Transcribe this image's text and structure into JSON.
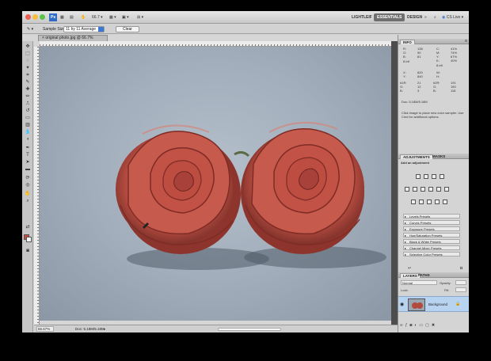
{
  "appbar": {
    "zoom": "66.7",
    "workspaces": [
      "LIGHTLEIF",
      "ESSENTIALS",
      "DESIGN"
    ],
    "cs_live": "CS Live"
  },
  "options": {
    "sample_size_label": "Sample Size:",
    "sample_size_value": "11 by 11 Average",
    "clear_label": "Clear"
  },
  "document": {
    "tab_title": "original photo.jpg @ 66.7% (RGB/8) *",
    "zoom_field": "66.67%",
    "doc_info": "Doc: 5.18M/5.18M"
  },
  "info_panel": {
    "tab": "INFO",
    "rgb": {
      "labels": "R:\nG:\nB:",
      "values": "138\n90\n81",
      "bit": "8-bit"
    },
    "cmyk": {
      "labels": "C:\nM:\nY:\nK:",
      "values": "41%\n74%\n67%\n40%",
      "bit": "8-bit"
    },
    "xy": {
      "labels": "X:\nY:",
      "values": "820\n840"
    },
    "wh": {
      "labels": "W:\nH:",
      "values": ""
    },
    "s1": {
      "labels": "#1R:\nG:\nB:",
      "values": "21\n12\n3"
    },
    "s2": {
      "labels": "#2R:\nG:\nB:",
      "values": "191\n150\n118"
    },
    "doc": "Doc: 5.18M/5.18M",
    "hint": "Click image to place new color sampler. Use Cmd for additional options."
  },
  "adjustments": {
    "tab_adj": "ADJUSTMENTS",
    "tab_masks": "MASKS",
    "heading": "Add an adjustment",
    "presets": [
      "Levels Presets",
      "Curves Presets",
      "Exposure Presets",
      "Hue/Saturation Presets",
      "Black & White Presets",
      "Channel Mixer Presets",
      "Selective Color Presets"
    ]
  },
  "layers": {
    "tab_layers": "LAYERS",
    "tab_paths": "PATHS",
    "blend_mode": "Normal",
    "opacity_label": "Opacity:",
    "lock_label": "Lock:",
    "fill_label": "Fill:",
    "layer_name": "Background"
  },
  "colors": {
    "foreground": "#cc4c3c",
    "background": "#ffffff",
    "rose": "#c9574a",
    "backdrop": "#a7b2be"
  }
}
